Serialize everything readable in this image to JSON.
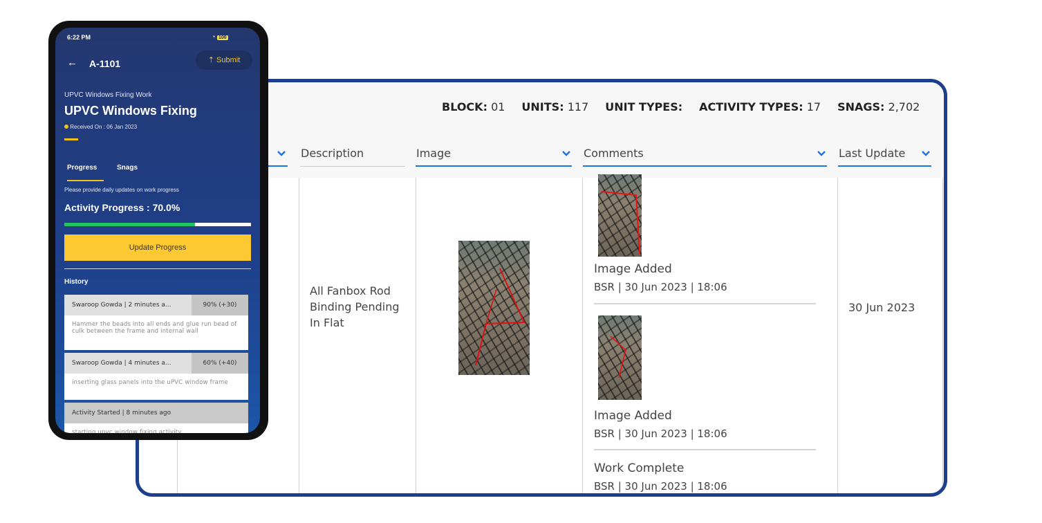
{
  "desktop": {
    "stats": [
      {
        "key": "BLOCK:",
        "value": "01"
      },
      {
        "key": "UNITS:",
        "value": "117"
      },
      {
        "key": "UNIT TYPES:",
        "value": ""
      },
      {
        "key": "ACTIVITY TYPES:",
        "value": "17"
      },
      {
        "key": "SNAGS:",
        "value": "2,702"
      }
    ],
    "columns": {
      "description": "Description",
      "image": "Image",
      "comments": "Comments",
      "last_update": "Last Update"
    },
    "row": {
      "description": "All Fanbox Rod Binding Pending In Flat",
      "last_update": "30 Jun 2023",
      "comments": [
        {
          "title": "Image Added",
          "meta": "BSR | 30 Jun 2023 | 18:06"
        },
        {
          "title": "Image Added",
          "meta": "BSR | 30 Jun 2023 | 18:06"
        },
        {
          "title": "Work Complete",
          "meta": "BSR | 30 Jun 2023 | 18:06"
        }
      ]
    },
    "colors": {
      "frame": "#1e3f8c",
      "accent": "#1a73e8"
    }
  },
  "phone": {
    "status_time": "6:22 PM",
    "battery": "100",
    "title": "A-1101",
    "submit_label": "Submit",
    "category": "UPVC Windows Fixing Work",
    "activity_name": "UPVC Windows Fixing",
    "received": "Received On : 06 Jan 2023",
    "tabs": [
      "Progress",
      "Snags"
    ],
    "hint": "Please provide daily updates on work progress",
    "progress_label": "Activity Progress : 70.0%",
    "progress_value": 0.7,
    "update_button": "Update Progress",
    "history_title": "History",
    "history": [
      {
        "who": "Swaroop Gowda | 2 minutes a...",
        "pct": "90% (+30)",
        "note": "Hammer the beads into all ends and glue run bead of culk between the frame and internal wall"
      },
      {
        "who": "Swaroop Gowda | 4 minutes a...",
        "pct": "60% (+40)",
        "note": "inserting glass panels into the uPVC window frame"
      },
      {
        "who": "Activity Started | 8 minutes ago",
        "pct": "",
        "note": "starting upvc window fixing activity"
      }
    ],
    "colors": {
      "accent": "#f5c21b",
      "progress": "#22c55e"
    }
  }
}
